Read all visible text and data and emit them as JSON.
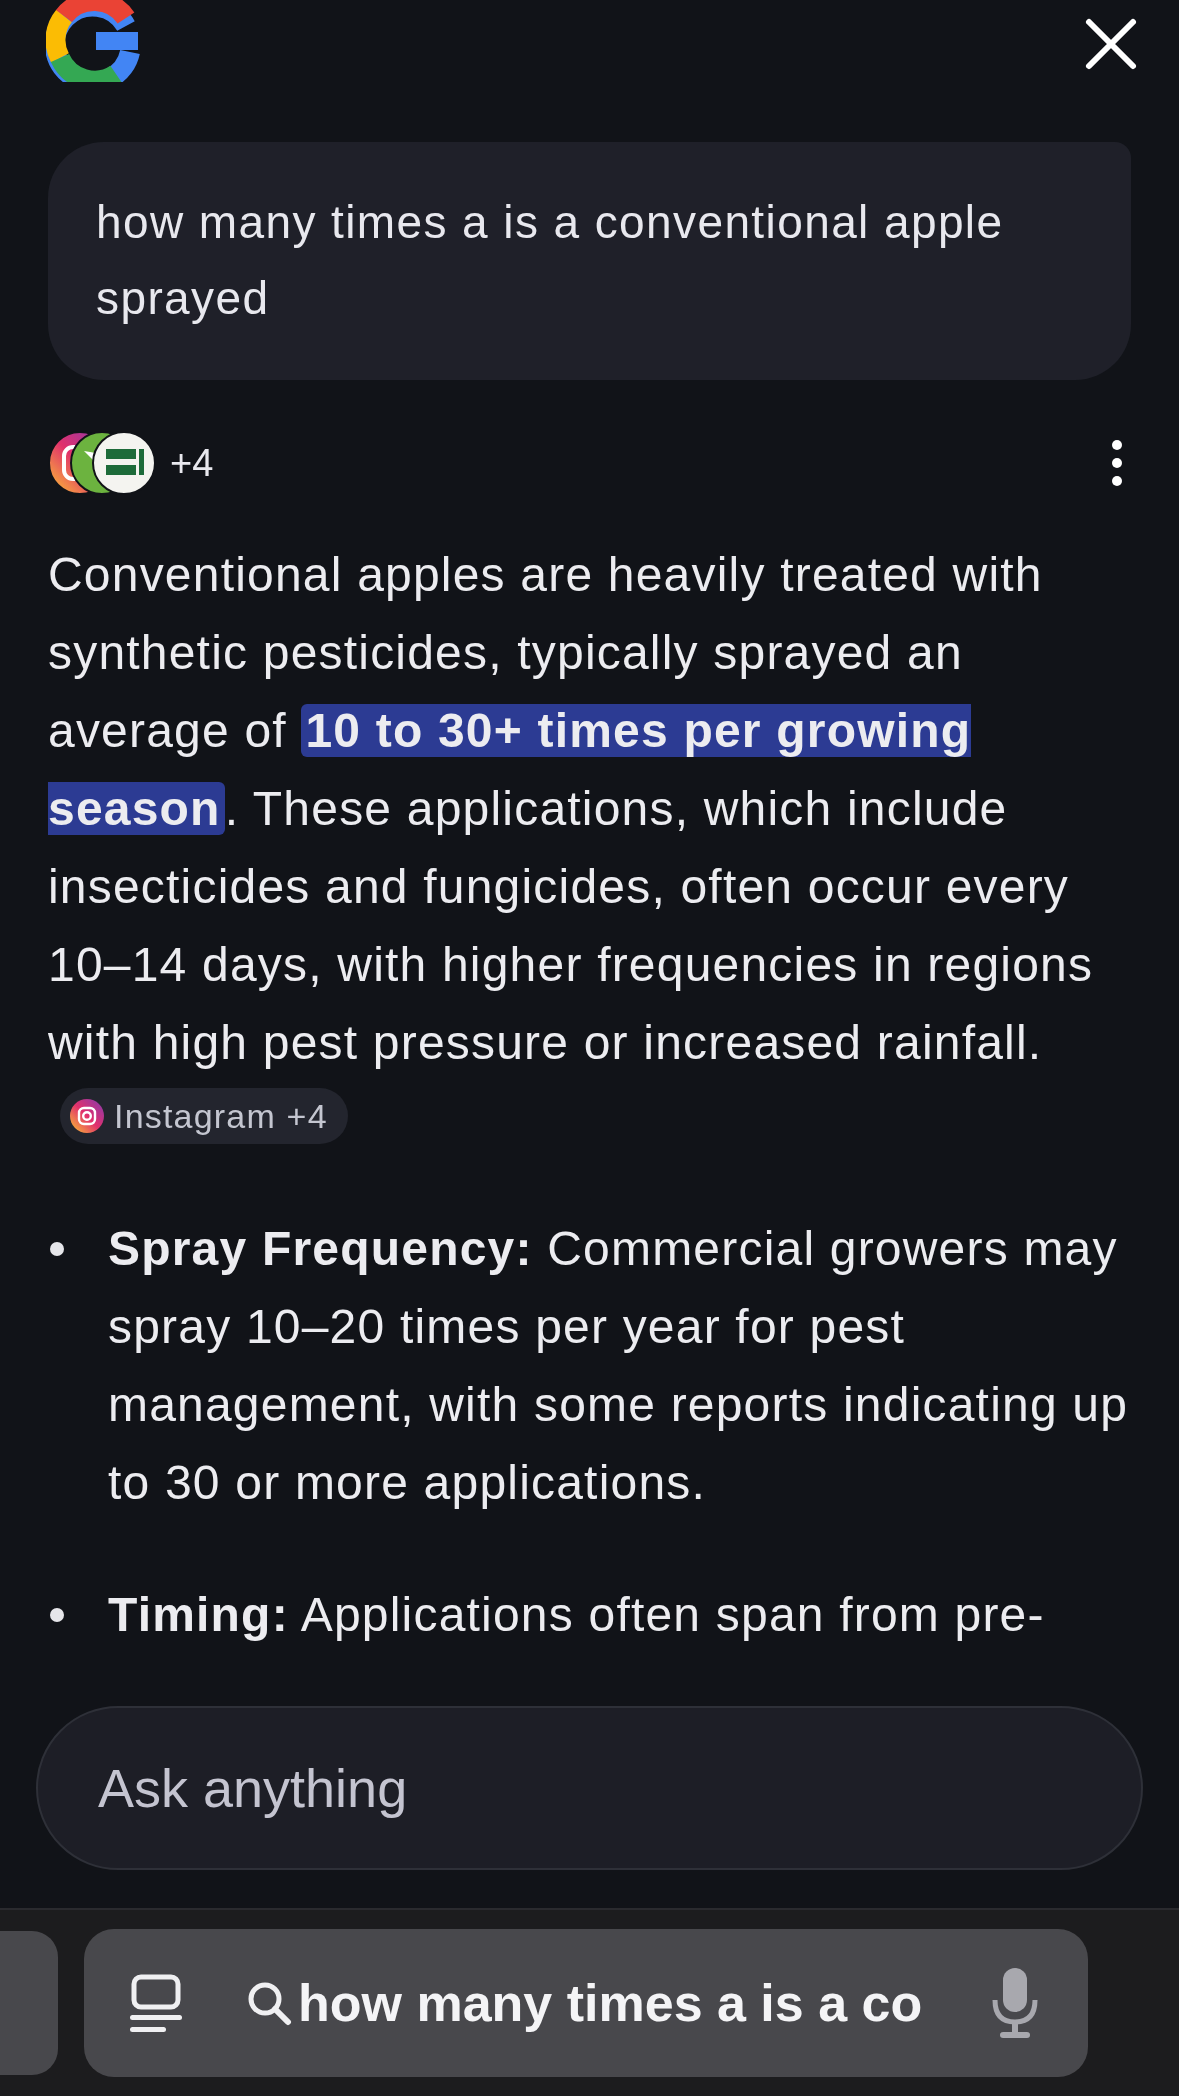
{
  "query": "how many times a is a conventional apple sprayed",
  "sources": {
    "count": "+4"
  },
  "answer": {
    "segments": [
      {
        "text": "Conventional apples are heavily treated with synthetic pesticides, typically sprayed an average of ",
        "highlighted": false
      },
      {
        "text": "10 to 30+ times per growing season",
        "highlighted": true
      },
      {
        "text": ". These applications, which include insecticides and fungicides, often occur every 10–14 days, with higher frequencies in regions with high pest pressure or increased rainfall.",
        "highlighted": false
      }
    ],
    "citation": "Instagram +4"
  },
  "bullets": [
    {
      "label": "Spray Frequency:",
      "text": "Commercial growers may spray 10–20 times per year for pest management, with some reports indicating up to 30 or more applications."
    },
    {
      "label": "Timing:",
      "text": "Applications often span from pre-"
    }
  ],
  "ask_field": {
    "placeholder": "Ask anything"
  },
  "address_bar": {
    "text": "how many times a is a co"
  }
}
